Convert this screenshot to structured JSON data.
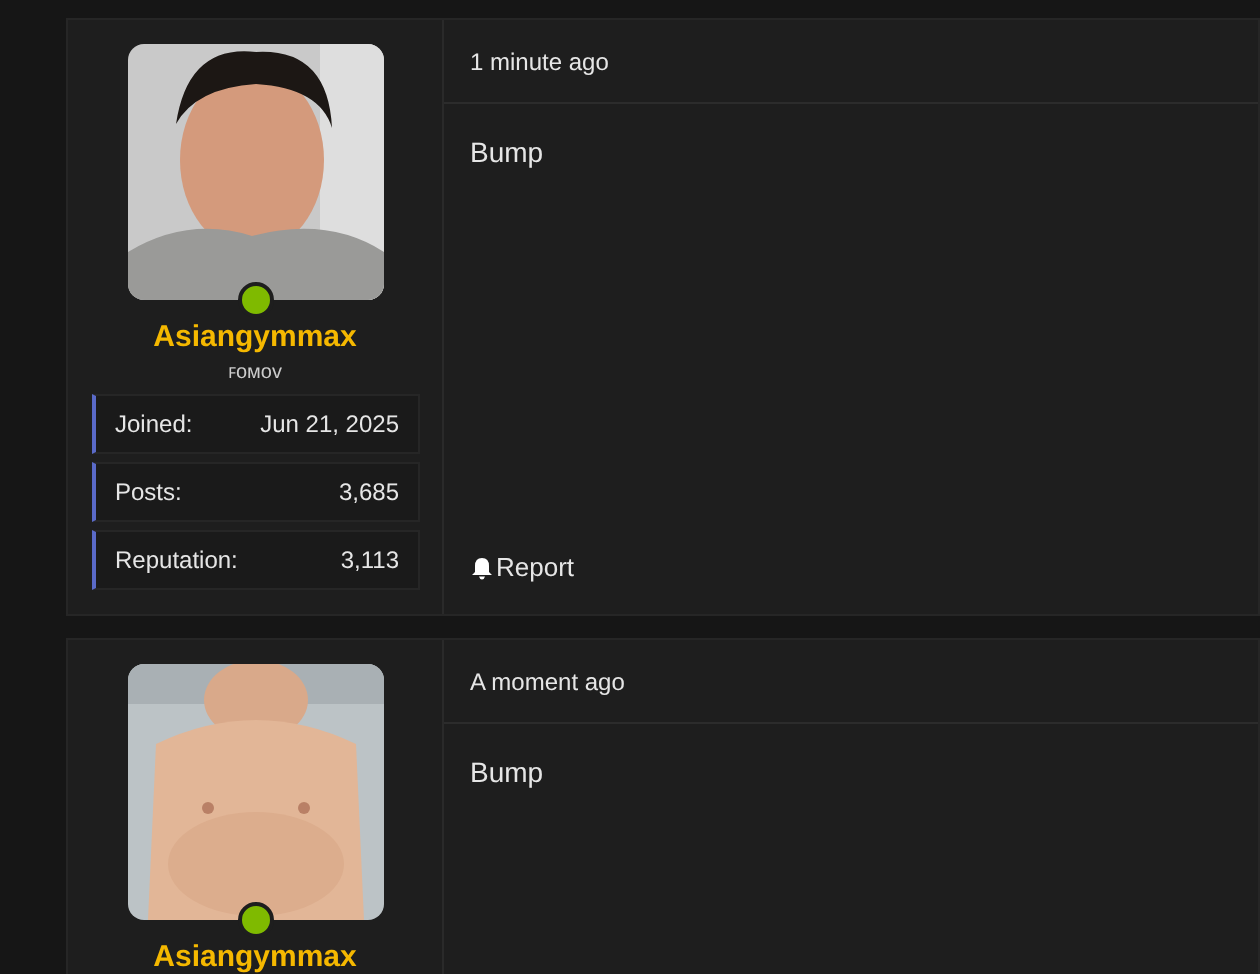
{
  "posts": [
    {
      "username": "Asiangymmax",
      "online": true,
      "user_title": "ꜰᴏᴍᴏᴠ",
      "avatar": {
        "kind": "picture"
      },
      "stats": [
        {
          "label": "Joined:",
          "value": "Jun 21, 2025"
        },
        {
          "label": "Posts:",
          "value": "3,685"
        },
        {
          "label": "Reputation:",
          "value": "3,113"
        }
      ],
      "time": "1 minute ago",
      "body": "Bump",
      "actions": [
        {
          "label": "Report"
        }
      ]
    },
    {
      "username": "Asiangymmax",
      "online": true,
      "avatar": {
        "kind": "picture"
      },
      "time": "A moment ago",
      "body": "Bump"
    }
  ]
}
